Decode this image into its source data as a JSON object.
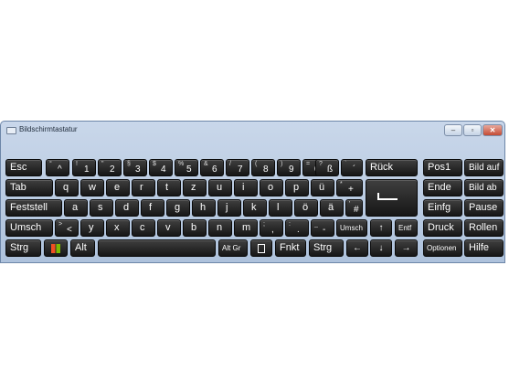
{
  "window": {
    "title": "Bildschirmtastatur",
    "buttons": {
      "minimize": "–",
      "maximize": "▫",
      "close": "✕"
    }
  },
  "row1": {
    "esc": "Esc",
    "k1": {
      "sup": "°",
      "main": "^"
    },
    "k2": {
      "sup": "!",
      "main": "1"
    },
    "k3": {
      "sup": "\"",
      "main": "2"
    },
    "k4": {
      "sup": "§",
      "main": "3"
    },
    "k5": {
      "sup": "$",
      "main": "4"
    },
    "k6": {
      "sup": "%",
      "main": "5"
    },
    "k7": {
      "sup": "&",
      "main": "6"
    },
    "k8": {
      "sup": "/",
      "main": "7"
    },
    "k9": {
      "sup": "(",
      "main": "8"
    },
    "k10": {
      "sup": ")",
      "main": "9"
    },
    "k11": {
      "sup": "=",
      "main": "0"
    },
    "k12": {
      "sup": "?",
      "main": "ß"
    },
    "k13": {
      "sup": "`",
      "main": "´"
    },
    "back": "Rück",
    "pos1": "Pos1",
    "bildauf": "Bild auf"
  },
  "row2": {
    "tab": "Tab",
    "letters": [
      "q",
      "w",
      "e",
      "r",
      "t",
      "z",
      "u",
      "i",
      "o",
      "p",
      "ü"
    ],
    "plus": {
      "sup": "*",
      "main": "+"
    },
    "ende": "Ende",
    "bildab": "Bild ab"
  },
  "row3": {
    "caps": "Feststell",
    "letters": [
      "a",
      "s",
      "d",
      "f",
      "g",
      "h",
      "j",
      "k",
      "l",
      "ö",
      "ä"
    ],
    "hash": {
      "sup": "'",
      "main": "#"
    },
    "einfg": "Einfg",
    "pause": "Pause"
  },
  "row4": {
    "shift": "Umsch",
    "lt": {
      "sup": ">",
      "main": "<"
    },
    "letters": [
      "y",
      "x",
      "c",
      "v",
      "b",
      "n",
      "m"
    ],
    "comma": {
      "sup": ";",
      "main": ","
    },
    "period": {
      "sup": ":",
      "main": "."
    },
    "dash": {
      "sup": "_",
      "main": "-"
    },
    "rshift": "Umsch",
    "up": "↑",
    "entf": "Entf",
    "druck": "Druck",
    "rollen": "Rollen"
  },
  "row5": {
    "strg": "Strg",
    "alt": "Alt",
    "altgr": "Alt Gr",
    "fnkt": "Fnkt",
    "strg2": "Strg",
    "left": "←",
    "down": "↓",
    "right": "→",
    "optionen": "Optionen",
    "hilfe": "Hilfe"
  },
  "colors": {
    "key": "#1f1f1f",
    "window": "#b8cbe3",
    "text": "#ffffff"
  }
}
